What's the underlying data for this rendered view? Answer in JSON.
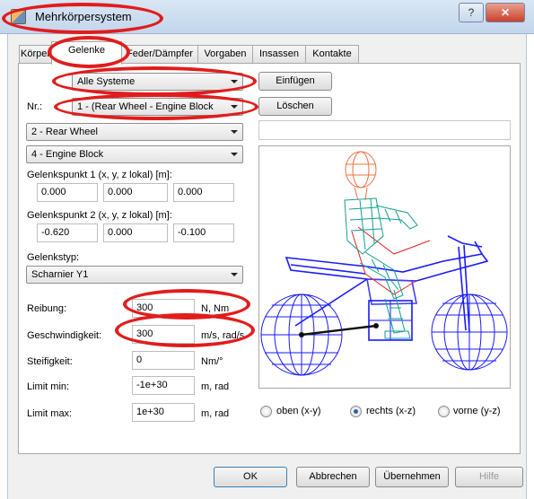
{
  "window": {
    "title": "Mehrkörpersystem",
    "help_glyph": "?",
    "close_glyph": "✕"
  },
  "tabs": [
    "Körper",
    "Gelenke",
    "Feder/Dämpfer",
    "Vorgaben",
    "Insassen",
    "Kontakte"
  ],
  "active_tab": "Gelenke",
  "systems_select": "Alle Systeme",
  "insert_button": "Einfügen",
  "nr_label": "Nr.:",
  "nr_select": "1 - (Rear Wheel - Engine Block",
  "delete_button": "Löschen",
  "body1_select": "2 - Rear Wheel",
  "body2_select": "4 - Engine Block",
  "point1": {
    "label": "Gelenkspunkt 1 (x, y, z lokal) [m]:",
    "x": "0.000",
    "y": "0.000",
    "z": "0.000"
  },
  "point2": {
    "label": "Gelenkspunkt 2 (x, y, z lokal) [m]:",
    "x": "-0.620",
    "y": "0.000",
    "z": "-0.100"
  },
  "joint_type": {
    "label": "Gelenkstyp:",
    "value": "Scharnier Y1"
  },
  "params": [
    {
      "label": "Reibung:",
      "value": "300",
      "unit": "N, Nm"
    },
    {
      "label": "Geschwindigkeit:",
      "value": "300",
      "unit": "m/s, rad/s"
    },
    {
      "label": "Steifigkeit:",
      "value": "0",
      "unit": "Nm/°"
    },
    {
      "label": "Limit min:",
      "value": "-1e+30",
      "unit": "m, rad"
    },
    {
      "label": "Limit max:",
      "value": "1e+30",
      "unit": "m, rad"
    }
  ],
  "views": [
    {
      "label": "oben (x-y)",
      "selected": false
    },
    {
      "label": "rechts (x-z)",
      "selected": true
    },
    {
      "label": "vorne (y-z)",
      "selected": false
    }
  ],
  "footer": {
    "ok": "OK",
    "cancel": "Abbrechen",
    "apply": "Übernehmen",
    "help": "Hilfe"
  },
  "colors": {
    "annotation": "#e11c1c",
    "wireframe_blue": "#1a1aff",
    "rider_green": "#119f8f",
    "rider_head": "#f07040"
  }
}
